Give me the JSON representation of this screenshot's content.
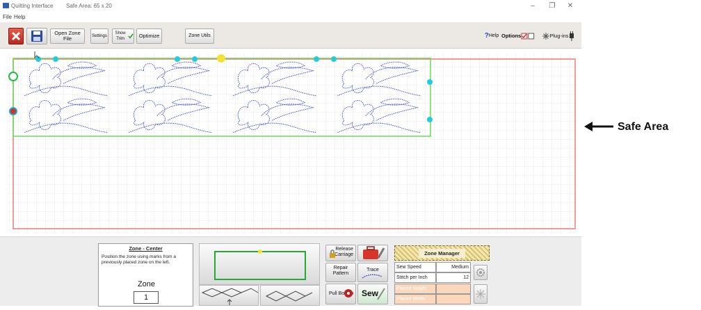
{
  "window": {
    "app_title": "Quilting Interface",
    "safe_area_title": "Safe Area: 65 x 20",
    "minimize_glyph": "–",
    "restore_glyph": "❐",
    "close_glyph": "✕"
  },
  "menu": {
    "file": "File",
    "help": "Help"
  },
  "toolbar": {
    "open_zone_file": "Open Zone File",
    "settings": "Settings",
    "show_trim": "Show Trim",
    "optimize": "Optimize",
    "zone_utils": "Zone Utils",
    "help": "Help",
    "help_mark": "?",
    "options": "Options",
    "plugins": "Plug-ins"
  },
  "zone_center": {
    "title": "Zone - Center",
    "description": "Position the zone using marks from a previously placed zone on the left.",
    "zone_label": "Zone",
    "zone_value": "1"
  },
  "actions": {
    "release_carriage": "Release Carriage",
    "repair_pattern": "Repair Pattern",
    "trace": "Trace",
    "pull_bobbin": "Pull Bobbin",
    "sew": "Sew"
  },
  "zone_manager": {
    "title": "Zone Manager",
    "rows": [
      {
        "label": "Sew Speed",
        "value": "Medium"
      },
      {
        "label": "Stitch per Inch",
        "value": "12"
      },
      {
        "label": "Placed Height",
        "value": ""
      },
      {
        "label": "Placed Width",
        "value": ""
      }
    ]
  },
  "annotation": {
    "label": "Safe Area"
  },
  "colors": {
    "safe_area_border": "#e87c7c",
    "zone_border": "#66dd55",
    "pattern_stitch": "#3344cc",
    "handle": "#22ccdd",
    "handle_active": "#f2e234",
    "close_button": "#d93a2b",
    "save_button": "#2a4d9a"
  }
}
